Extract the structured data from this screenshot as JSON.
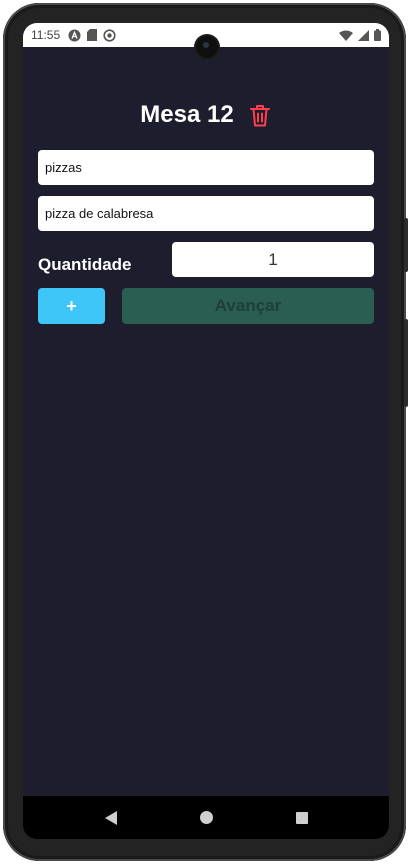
{
  "status_bar": {
    "time": "11:55",
    "left_icons": [
      "a-circle-icon",
      "sd-card-icon",
      "sync-circle-icon"
    ],
    "right_icons": [
      "wifi-icon",
      "signal-icon",
      "battery-icon"
    ]
  },
  "header": {
    "title": "Mesa 12",
    "delete_icon": "trash-icon"
  },
  "form": {
    "category_value": "pizzas",
    "product_value": "pizza de calabresa",
    "quantity_label": "Quantidade",
    "quantity_value": "1"
  },
  "actions": {
    "add_label": "+",
    "next_label": "Avançar"
  },
  "nav_bar": {
    "buttons": [
      "back-icon",
      "home-icon",
      "recents-icon"
    ]
  },
  "colors": {
    "background": "#1d1d2e",
    "add_button": "#3fc6f9",
    "next_button": "#2a5e52",
    "trash_icon": "#ff3f4b"
  }
}
